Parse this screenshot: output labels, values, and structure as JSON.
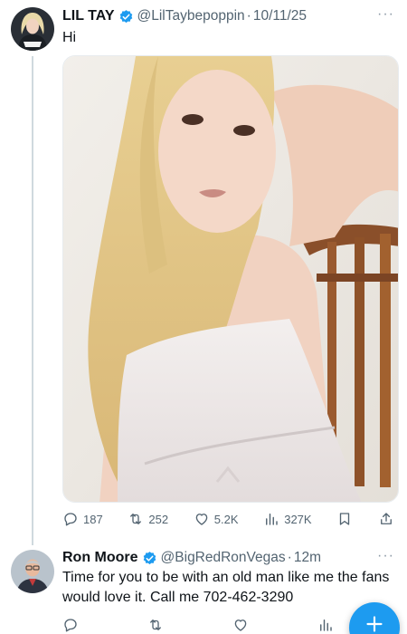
{
  "main_tweet": {
    "author_name": "LIL TAY",
    "handle": "@LilTaybepoppin",
    "separator": "·",
    "date": "10/11/25",
    "more": "···",
    "text": "Hi",
    "stats": {
      "replies": "187",
      "reposts": "252",
      "likes": "5.2K",
      "views": "327K"
    }
  },
  "reply_tweet": {
    "author_name": "Ron Moore",
    "handle": "@BigRedRonVegas",
    "separator": "·",
    "time": "12m",
    "more": "···",
    "text": "Time for you to be with an old man like me the fans would love it. Call me 702-462-3290"
  },
  "icons": {
    "verified": "verified-badge-icon",
    "reply": "reply-icon",
    "repost": "repost-icon",
    "like": "heart-icon",
    "views": "views-icon",
    "bookmark": "bookmark-icon",
    "share": "share-icon",
    "compose": "plus-icon"
  },
  "colors": {
    "accent": "#1d9bf0",
    "secondary_text": "#536471",
    "thread_line": "#cfd9de"
  }
}
